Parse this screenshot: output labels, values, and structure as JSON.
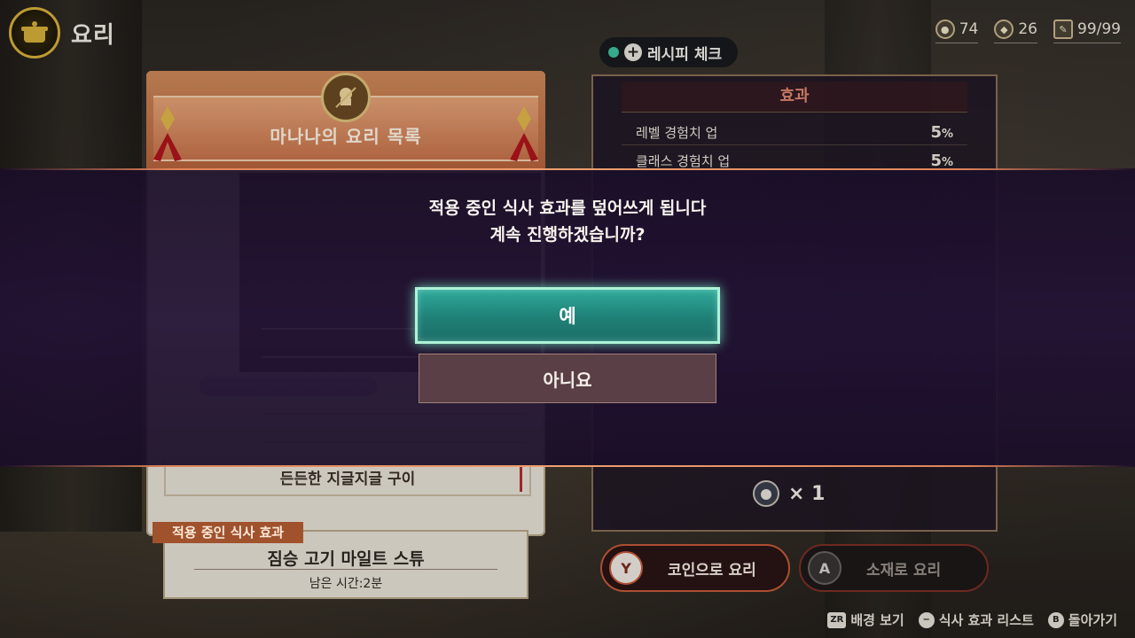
{
  "header": {
    "title": "요리",
    "icon": "cooking-pot-icon"
  },
  "currencies": [
    {
      "icon": "coin-icon",
      "value": "74"
    },
    {
      "icon": "drop-icon",
      "value": "26"
    },
    {
      "icon": "ingredient-icon",
      "value": "99/99"
    }
  ],
  "recipe_check": {
    "label": "레시피 체크"
  },
  "recipe_book": {
    "title": "마나나의 요리 목록",
    "selected_dish": "든든한 지글지글 구이"
  },
  "active_effect": {
    "tag": "적용 중인 식사 효과",
    "name": "짐승 고기 마일트 스튜",
    "time_left": "남은 시간:2분"
  },
  "effects": {
    "title": "효과",
    "rows": [
      {
        "label": "레벨 경험치 업",
        "value": "5",
        "unit": "%"
      },
      {
        "label": "클래스 경험치 업",
        "value": "5",
        "unit": "%"
      }
    ],
    "cost": "× 1"
  },
  "dialog": {
    "line1": "적용 중인 식사 효과를 덮어쓰게 됩니다",
    "line2": "계속 진행하겠습니까?",
    "yes": "예",
    "no": "아니요"
  },
  "cook_buttons": {
    "coin": {
      "key": "Y",
      "label": "코인으로 요리"
    },
    "material": {
      "key": "A",
      "label": "소재로 요리"
    }
  },
  "hints": [
    {
      "key": "ZR",
      "label": "배경 보기"
    },
    {
      "key": "−",
      "label": "식사 효과 리스트"
    },
    {
      "key": "B",
      "label": "돌아가기"
    }
  ],
  "colors": {
    "accent_teal": "#2fa99a",
    "dialog_bg": "#22123a",
    "highlight_orange": "#e0835a"
  }
}
